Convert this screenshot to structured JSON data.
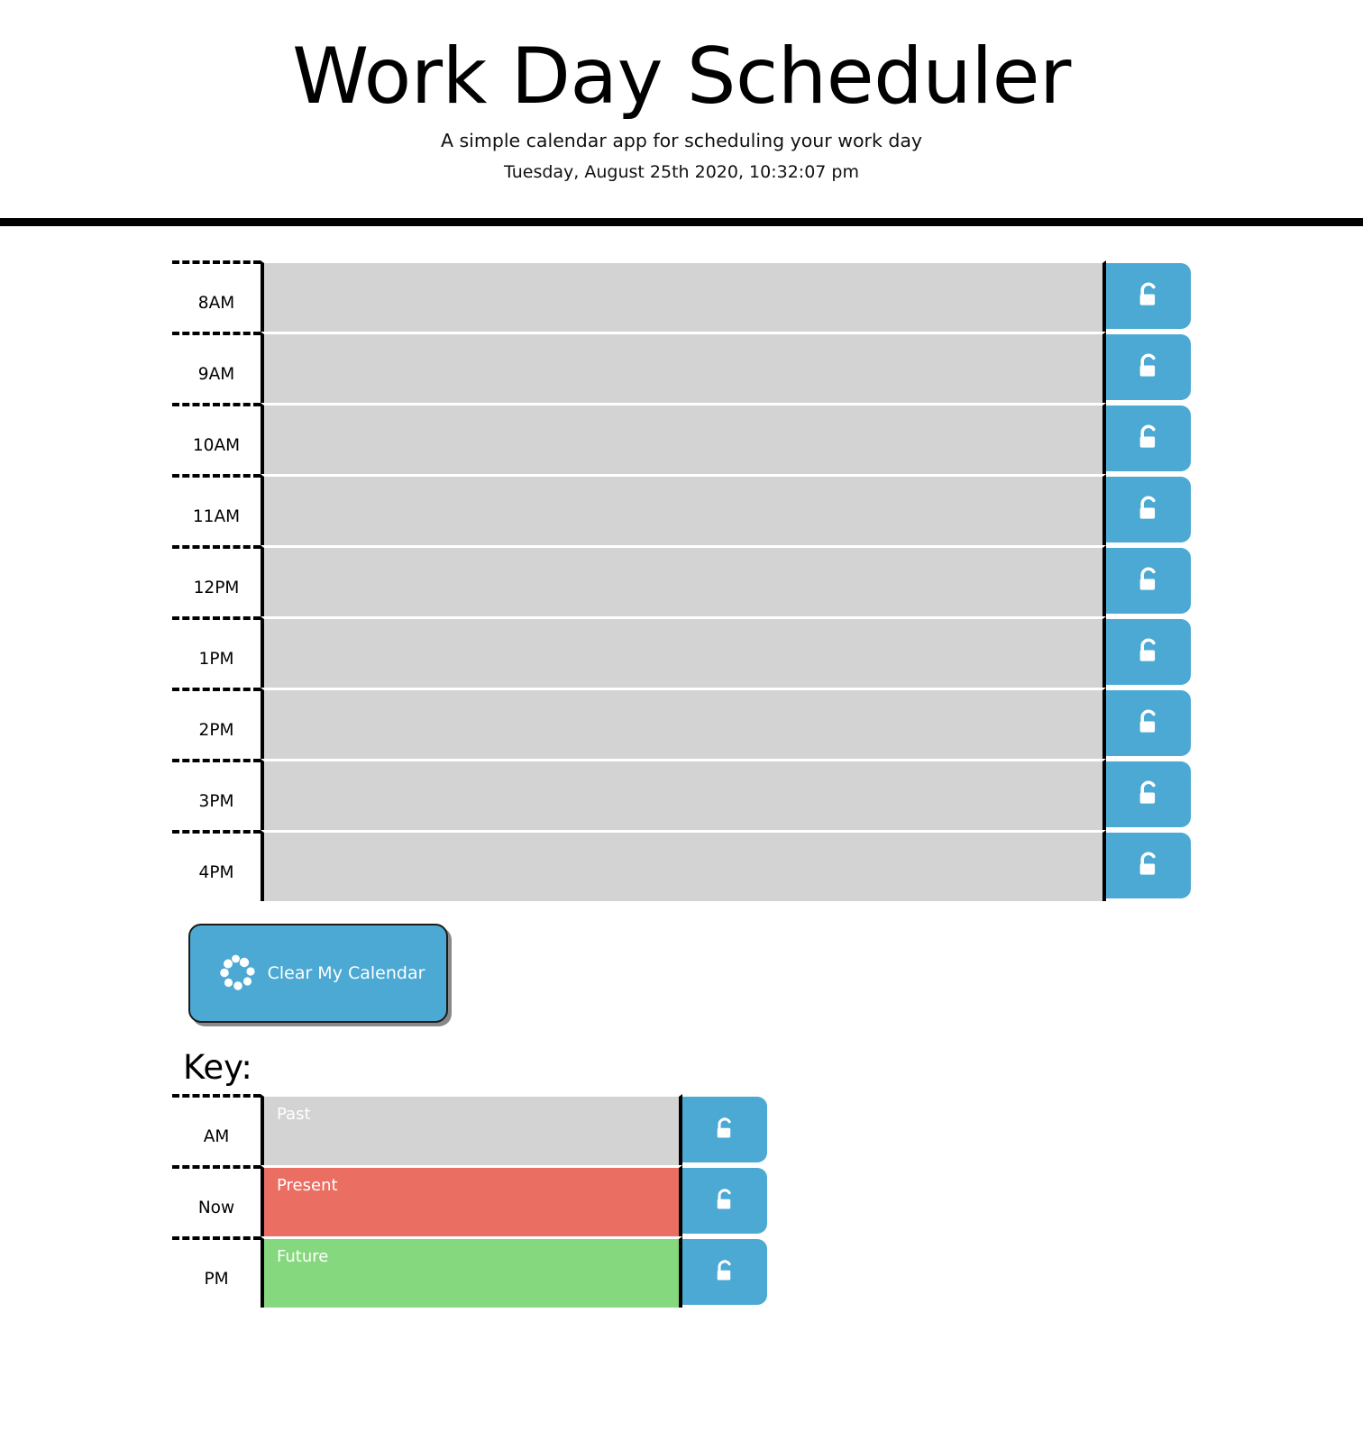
{
  "header": {
    "title": "Work Day Scheduler",
    "tagline": "A simple calendar app for scheduling your work day",
    "datetime": "Tuesday, August 25th 2020, 10:32:07 pm"
  },
  "colors": {
    "accent_blue": "#4ba9d4",
    "past_gray": "#d3d3d3",
    "present_red": "#ea6e62",
    "future_green": "#85d87e",
    "border_black": "#000000"
  },
  "icons": {
    "save": "unlock-padlock-icon",
    "clear": "spinner-circle-icon"
  },
  "schedule": {
    "textarea_placeholder": "",
    "rows": [
      {
        "hour": "8AM",
        "state": "past",
        "text": ""
      },
      {
        "hour": "9AM",
        "state": "past",
        "text": ""
      },
      {
        "hour": "10AM",
        "state": "past",
        "text": ""
      },
      {
        "hour": "11AM",
        "state": "past",
        "text": ""
      },
      {
        "hour": "12PM",
        "state": "past",
        "text": ""
      },
      {
        "hour": "1PM",
        "state": "past",
        "text": ""
      },
      {
        "hour": "2PM",
        "state": "past",
        "text": ""
      },
      {
        "hour": "3PM",
        "state": "past",
        "text": ""
      },
      {
        "hour": "4PM",
        "state": "past",
        "text": ""
      }
    ]
  },
  "clear_button": {
    "label": "Clear My Calendar"
  },
  "key": {
    "heading": "Key:",
    "rows": [
      {
        "hour": "AM",
        "state": "past",
        "text": "Past"
      },
      {
        "hour": "Now",
        "state": "present",
        "text": "Present"
      },
      {
        "hour": "PM",
        "state": "future",
        "text": "Future"
      }
    ]
  }
}
